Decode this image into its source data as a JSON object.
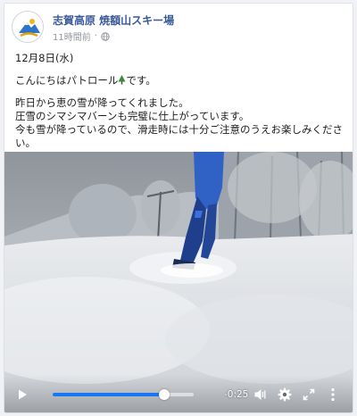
{
  "post": {
    "page_name": "志賀高原 焼額山スキー場",
    "time_ago": "11時間前",
    "separator": "·",
    "lines": {
      "date": "12月8日(水)",
      "greeting_a": "こんにちはパトロール",
      "greeting_b": "です。",
      "line1": "昨日から恵の雪が降ってくれました。",
      "line2": "圧雪のシマシマバーンも完璧に仕上がっています。",
      "line3": "今も雪が降っているので、滑走時には十分ご注意のうえお楽しみくださ",
      "line4": "い。"
    }
  },
  "video": {
    "progress": 0.79,
    "time_remaining": "-0:25",
    "accent": "#1877f2",
    "icons": [
      "play-icon",
      "volume-icon",
      "settings-icon",
      "fullscreen-icon",
      "more-options-icon"
    ]
  },
  "colors": {
    "link": "#385898",
    "muted": "#90949c"
  }
}
